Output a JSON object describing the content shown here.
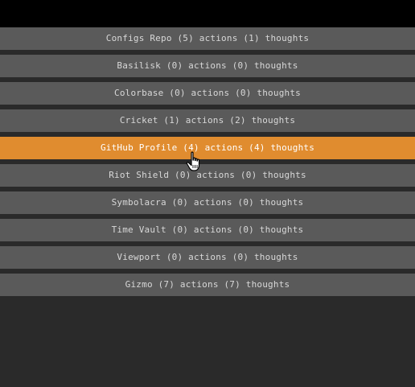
{
  "items": [
    {
      "label": "Configs Repo (5) actions (1) thoughts",
      "active": false
    },
    {
      "label": "Basilisk (0) actions (0) thoughts",
      "active": false
    },
    {
      "label": "Colorbase (0) actions (0) thoughts",
      "active": false
    },
    {
      "label": "Cricket (1) actions (2) thoughts",
      "active": false
    },
    {
      "label": "GitHub Profile (4) actions (4) thoughts",
      "active": true
    },
    {
      "label": "Riot Shield (0) actions (0) thoughts",
      "active": false
    },
    {
      "label": "Symbolacra (0) actions (0) thoughts",
      "active": false
    },
    {
      "label": "Time Vault (0) actions (0) thoughts",
      "active": false
    },
    {
      "label": "Viewport (0) actions (0) thoughts",
      "active": false
    },
    {
      "label": "Gizmo (7) actions (7) thoughts",
      "active": false
    }
  ],
  "colors": {
    "background": "#2a2a2a",
    "topbar": "#000000",
    "item": "#5a5a5a",
    "item_active": "#e08c2f"
  },
  "cursor_icon": "hand-pointer-icon"
}
